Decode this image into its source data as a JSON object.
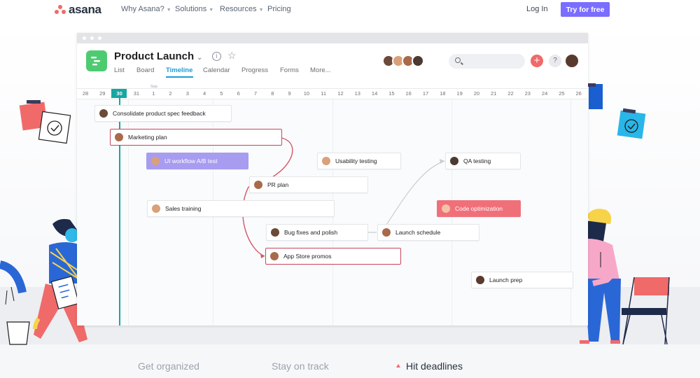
{
  "brand": {
    "logo_text": "asana",
    "logo_color": "#f06a6a"
  },
  "nav": {
    "links": [
      {
        "label": "Why Asana?",
        "dropdown": true
      },
      {
        "label": "Solutions",
        "dropdown": true
      },
      {
        "label": "Resources",
        "dropdown": true
      },
      {
        "label": "Pricing",
        "dropdown": false
      }
    ],
    "login_label": "Log In",
    "cta_label": "Try for free",
    "cta_color": "#796eff"
  },
  "app": {
    "project_title": "Product Launch",
    "project_icon": "timeline-icon",
    "project_icon_color": "#4ecb71",
    "tabs": [
      {
        "label": "List",
        "active": false
      },
      {
        "label": "Board",
        "active": false
      },
      {
        "label": "Timeline",
        "active": true
      },
      {
        "label": "Calendar",
        "active": false
      },
      {
        "label": "Progress",
        "active": false
      },
      {
        "label": "Forms",
        "active": false
      },
      {
        "label": "More...",
        "active": false
      }
    ],
    "search_placeholder": "",
    "add_button_color": "#f06a6a",
    "help_label": "?",
    "month_label": "Sep",
    "dates": [
      "28",
      "29",
      "30",
      "31",
      "1",
      "2",
      "3",
      "4",
      "5",
      "6",
      "7",
      "8",
      "9",
      "10",
      "11",
      "12",
      "13",
      "14",
      "15",
      "16",
      "17",
      "18",
      "19",
      "20",
      "21",
      "22",
      "23",
      "24",
      "25",
      "26"
    ],
    "today": "30",
    "accent_color": "#16a7a2",
    "tasks": [
      {
        "name": "Consolidate product spec feedback",
        "style": "normal"
      },
      {
        "name": "Marketing plan",
        "style": "selected"
      },
      {
        "name": "UI workflow A/B test",
        "style": "purple"
      },
      {
        "name": "Usability testing",
        "style": "normal"
      },
      {
        "name": "QA testing",
        "style": "normal"
      },
      {
        "name": "PR plan",
        "style": "normal"
      },
      {
        "name": "Sales training",
        "style": "normal"
      },
      {
        "name": "Code optimization",
        "style": "coral"
      },
      {
        "name": "Bug fixes and polish",
        "style": "normal"
      },
      {
        "name": "Launch schedule",
        "style": "normal"
      },
      {
        "name": "App Store promos",
        "style": "selected"
      },
      {
        "name": "Launch prep",
        "style": "normal"
      }
    ]
  },
  "taglines": [
    {
      "label": "Get organized",
      "active": false
    },
    {
      "label": "Stay on track",
      "active": false
    },
    {
      "label": "Hit deadlines",
      "active": true
    }
  ]
}
